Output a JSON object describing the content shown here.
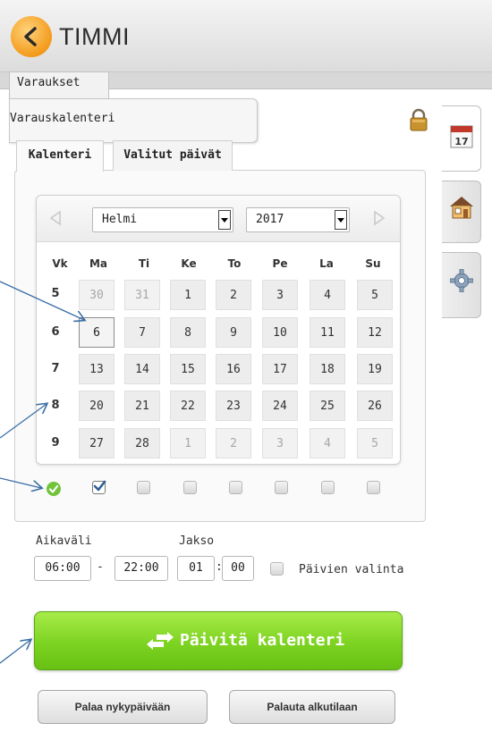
{
  "app": {
    "title": "TIMMI"
  },
  "tabs": {
    "main": "Varaukset",
    "submenu": "Varauskalenteri"
  },
  "subtabs": [
    "Kalenteri",
    "Valitut päivät"
  ],
  "calendar": {
    "month": "Helmi",
    "year": "2017",
    "headers": [
      "Vk",
      "Ma",
      "Ti",
      "Ke",
      "To",
      "Pe",
      "La",
      "Su"
    ],
    "weeks": [
      {
        "week": "5",
        "days": [
          "30",
          "31",
          "1",
          "2",
          "3",
          "4",
          "5"
        ]
      },
      {
        "week": "6",
        "days": [
          "6",
          "7",
          "8",
          "9",
          "10",
          "11",
          "12"
        ]
      },
      {
        "week": "7",
        "days": [
          "13",
          "14",
          "15",
          "16",
          "17",
          "18",
          "19"
        ]
      },
      {
        "week": "8",
        "days": [
          "20",
          "21",
          "22",
          "23",
          "24",
          "25",
          "26"
        ]
      },
      {
        "week": "9",
        "days": [
          "27",
          "28",
          "1",
          "2",
          "3",
          "4",
          "5"
        ]
      }
    ],
    "day_checkboxes": [
      true,
      false,
      false,
      false,
      false,
      false,
      false
    ]
  },
  "time": {
    "aikavali_label": "Aikaväli",
    "jakso_label": "Jakso",
    "start": "06:00",
    "dash": "-",
    "end": "22:00",
    "jakso_hours": "01",
    "jakso_sep": ":",
    "jakso_minutes": "00",
    "paivien_valinta": "Päivien valinta"
  },
  "buttons": {
    "update": "Päivitä kalenteri",
    "today": "Palaa nykypäivään",
    "reset": "Palauta alkutilaan"
  },
  "side_tabs": {
    "calendar_icon_day": "17"
  },
  "colors": {
    "accent_green": "#7dd321",
    "logo_orange": "#f39b1c",
    "annotation_arrow": "#3a6ea5"
  }
}
